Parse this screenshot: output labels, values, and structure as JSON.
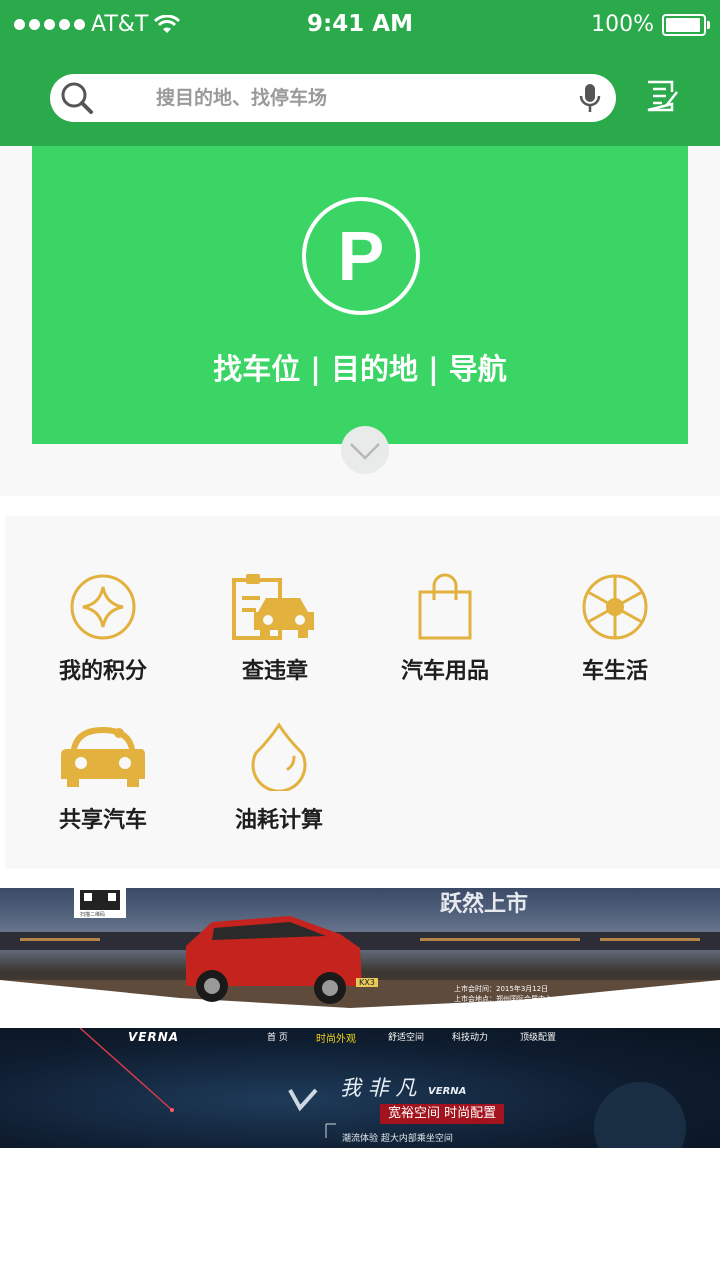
{
  "status_bar": {
    "carrier": "AT&T",
    "time": "9:41 AM",
    "battery": "100%"
  },
  "search": {
    "placeholder": "搜目的地、找停车场"
  },
  "hero": {
    "parking_letter": "P",
    "tagline": "找车位 | 目的地 | 导航"
  },
  "services": [
    {
      "label": "我的积分",
      "icon": "points-icon"
    },
    {
      "label": "查违章",
      "icon": "violation-check-icon"
    },
    {
      "label": "汽车用品",
      "icon": "shopping-bag-icon"
    },
    {
      "label": "车生活",
      "icon": "car-life-icon"
    },
    {
      "label": "共享汽车",
      "icon": "shared-car-icon"
    },
    {
      "label": "油耗计算",
      "icon": "fuel-drop-icon"
    }
  ],
  "banner1": {
    "headline": "跃然上市",
    "qr_caption": "扫描二维码",
    "info_lines": [
      "上市会时间：2015年3月12日",
      "上市会地点：郑州国际会展中心"
    ],
    "plate": "KX3"
  },
  "banner2": {
    "brand": "VERNA",
    "nav": [
      "首 页",
      "时尚外观",
      "舒适空间",
      "科技动力",
      "顶级配置"
    ],
    "slogan": "我 非 凡",
    "slogan_brand": "VERNA",
    "tag": "宽裕空间  时尚配置",
    "line1": "潮流体验  超大内部乘坐空间"
  },
  "colors": {
    "header_green": "#2aaa4a",
    "hero_green": "#3bd565",
    "icon_gold": "#e2b13e"
  }
}
